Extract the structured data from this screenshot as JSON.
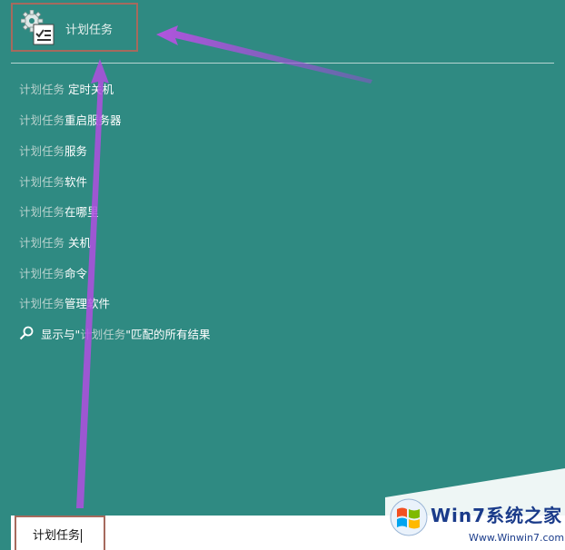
{
  "top_result": {
    "label": "计划任务",
    "icon": "task-scheduler-icon"
  },
  "suggestions": [
    {
      "prefix": "计划任务",
      "suffix": " 定时关机"
    },
    {
      "prefix": "计划任务",
      "suffix": "重启服务器"
    },
    {
      "prefix": "计划任务",
      "suffix": "服务"
    },
    {
      "prefix": "计划任务",
      "suffix": "软件"
    },
    {
      "prefix": "计划任务",
      "suffix": "在哪里"
    },
    {
      "prefix": "计划任务",
      "suffix": " 关机"
    },
    {
      "prefix": "计划任务",
      "suffix": "命令"
    },
    {
      "prefix": "计划任务",
      "suffix": "管理软件"
    }
  ],
  "search_all": {
    "pre": "显示与\"",
    "query": "计划任务",
    "post": "\"匹配的所有结果",
    "icon": "search-icon"
  },
  "search_box": {
    "value": "计划任务"
  },
  "watermark": {
    "brand_text": "Win7系统之家",
    "url": "Www.Winwin7.com"
  },
  "colors": {
    "background": "#2f8a82",
    "highlight_border": "#a66a5d",
    "arrow": "#b04ee0"
  }
}
